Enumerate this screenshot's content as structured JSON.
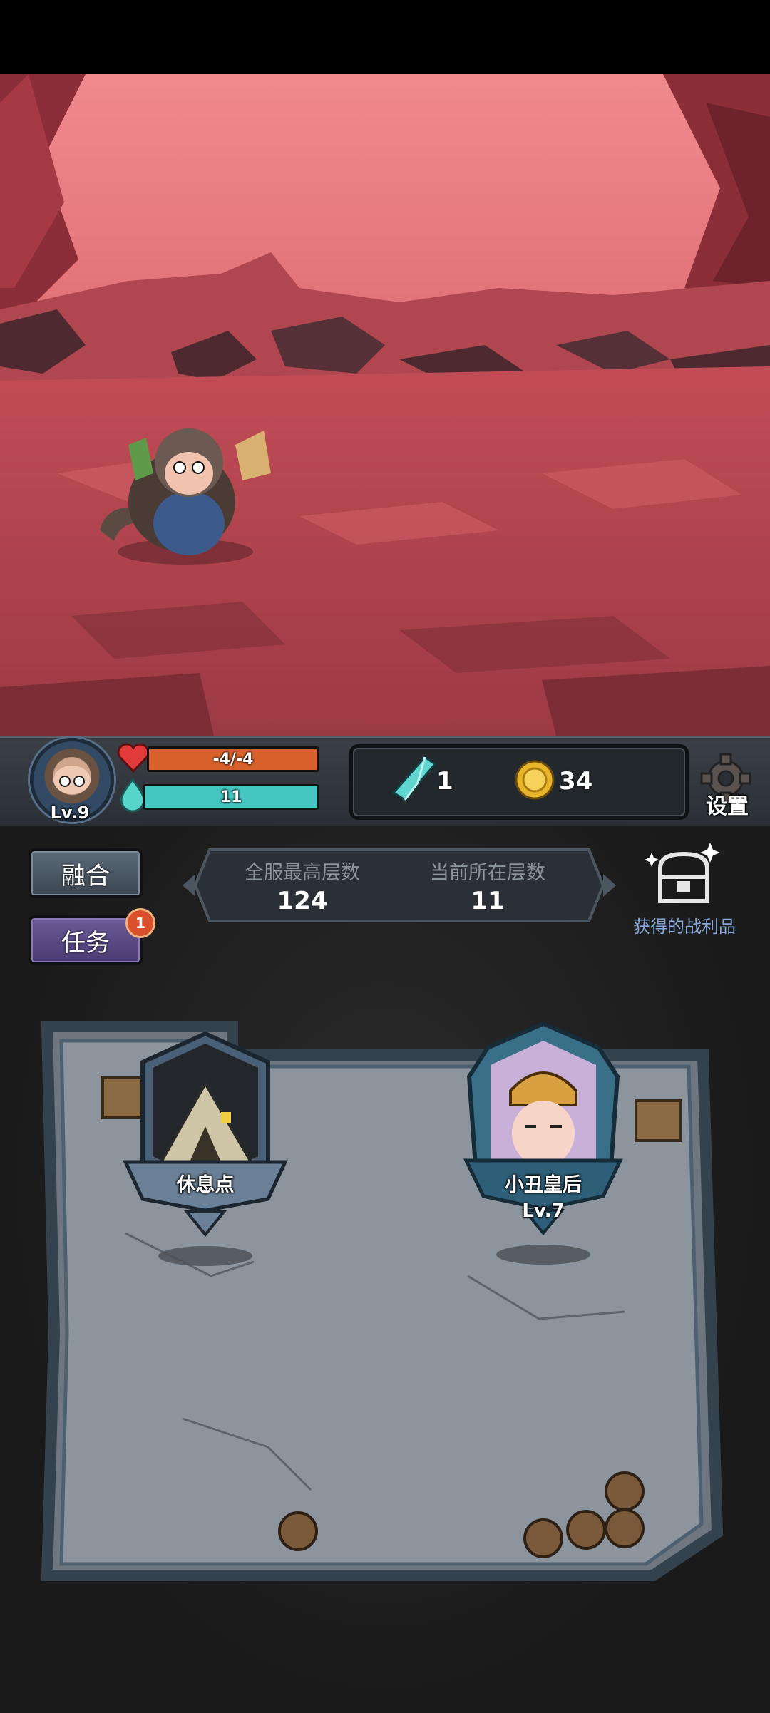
{
  "player": {
    "level": "Lv.9",
    "hp_text": "-4/-4",
    "hp_fraction": 1.0,
    "mana_text": "11",
    "mana_fraction": 1.0
  },
  "resources": {
    "crystal": "1",
    "coins": "34"
  },
  "settings_label": "设置",
  "buttons": {
    "merge": "融合",
    "quest": "任务",
    "quest_badge": "1"
  },
  "floors": {
    "server_best_label": "全服最高层数",
    "server_best_value": "124",
    "current_label": "当前所在层数",
    "current_value": "11"
  },
  "loot_label": "获得的战利品",
  "map_nodes": [
    {
      "label": "休息点",
      "level": ""
    },
    {
      "label": "小丑皇后",
      "level": "Lv.7"
    }
  ],
  "colors": {
    "hp": "#d9622c",
    "mana": "#46c6c0",
    "scene_sky": "#e0626c",
    "scene_ground": "#b84a52"
  },
  "icons": [
    "heart-icon",
    "mana-drop-icon",
    "crystal-icon",
    "coin-icon",
    "gear-icon",
    "treasure-chest-icon",
    "tent-icon"
  ]
}
